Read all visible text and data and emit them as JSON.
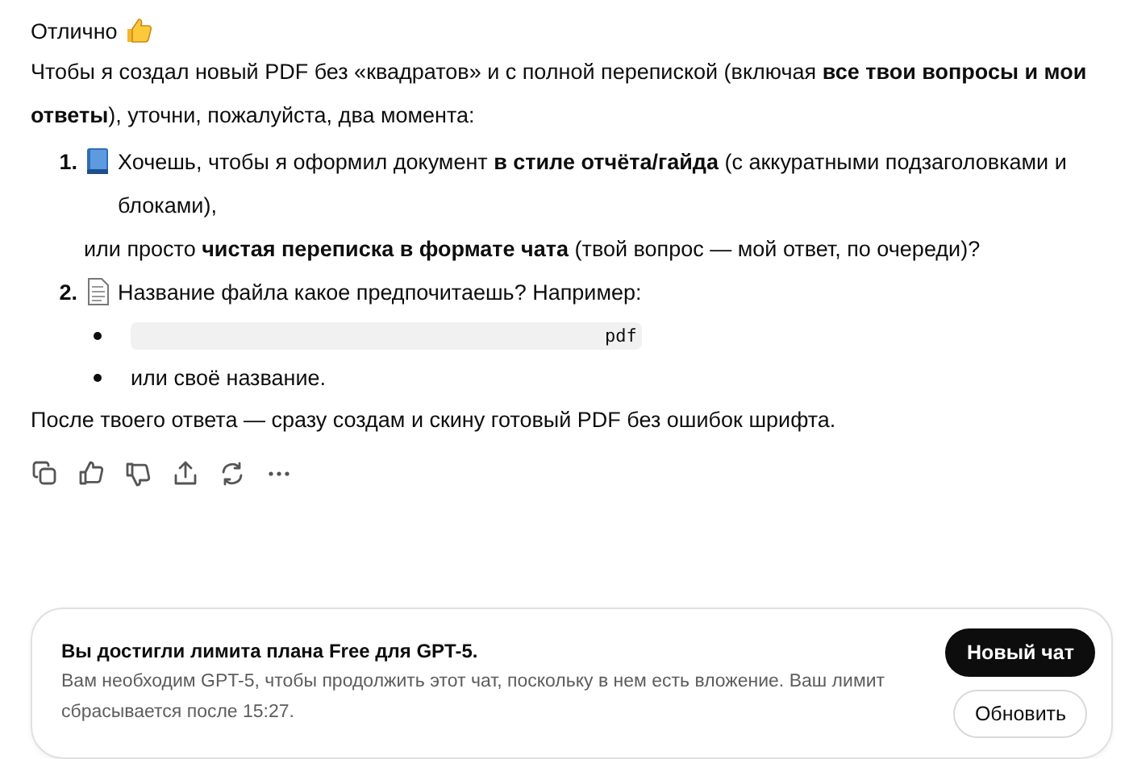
{
  "message": {
    "greeting": "Отлично",
    "intro": "Чтобы я создал новый PDF без «квадратов» и с полной перепиской (включая **все твои вопросы и мои ответы**), уточни, пожалуйста, два момента:",
    "items": [
      {
        "number": "1.",
        "kind": "choice",
        "lines": [
          "Хочешь, чтобы я оформил документ **в стиле отчёта/гайда** (с аккуратными подзаголовками и блоками),",
          "или просто **чистая переписка в формате чата** (твой вопрос — мой ответ, по очереди)?"
        ]
      },
      {
        "number": "2.",
        "kind": "filename",
        "lines": [
          "Название файла какое предпочитаешь? Например:"
        ],
        "bullets": [
          {
            "kind": "code",
            "text": "pdf"
          },
          {
            "kind": "text",
            "text": "или своё название."
          }
        ]
      }
    ],
    "outro": "После твоего ответа — сразу создам и скину готовый PDF без ошибок шрифта."
  },
  "limit_notice": {
    "title": "Вы достигли лимита плана Free для GPT-5.",
    "text": "Вам необходим GPT-5, чтобы продолжить этот чат, поскольку в нем есть вложение. Ваш лимит сбрасывается после 15:27.",
    "buttons": [
      {
        "label": "Новый чат",
        "kind": "primary"
      },
      {
        "label": "Обновить",
        "kind": "secondary"
      }
    ]
  }
}
